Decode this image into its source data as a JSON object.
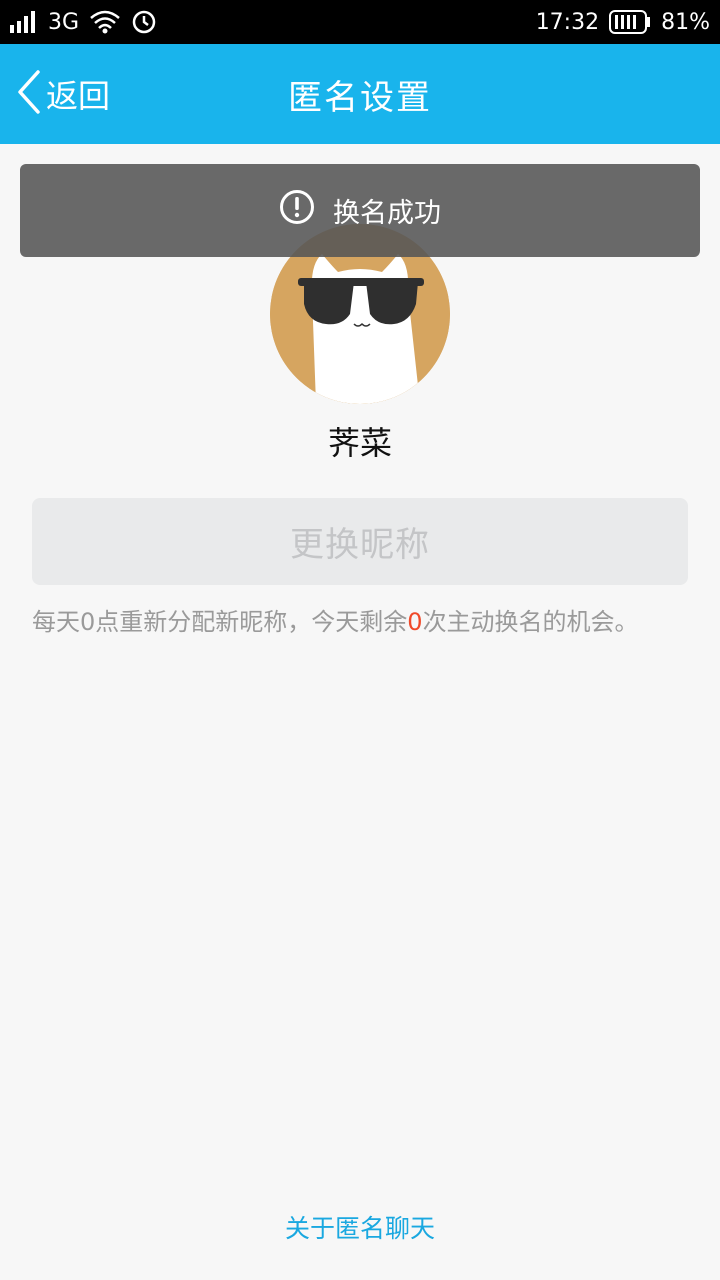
{
  "status_bar": {
    "network": "3G",
    "time": "17:32",
    "battery": "81%",
    "icons": [
      "signal-icon",
      "wifi-icon",
      "alarm-icon",
      "battery-icon"
    ]
  },
  "nav": {
    "back_label": "返回",
    "title": "匿名设置"
  },
  "toast": {
    "message": "换名成功",
    "icon": "exclamation-circle-icon"
  },
  "profile": {
    "nickname": "荠菜",
    "avatar": "cat-with-sunglasses-avatar"
  },
  "change_button": {
    "label": "更换昵称",
    "enabled": false
  },
  "hint": {
    "prefix": "每天0点重新分配新昵称，今天剩余",
    "count": "0",
    "suffix": "次主动换名的机会。"
  },
  "footer": {
    "about_link": "关于匿名聊天"
  },
  "colors": {
    "nav_bg": "#19b4ec",
    "count_red": "#f04a2a",
    "link_blue": "#1aa8e0",
    "avatar_bg": "#d6a560"
  }
}
